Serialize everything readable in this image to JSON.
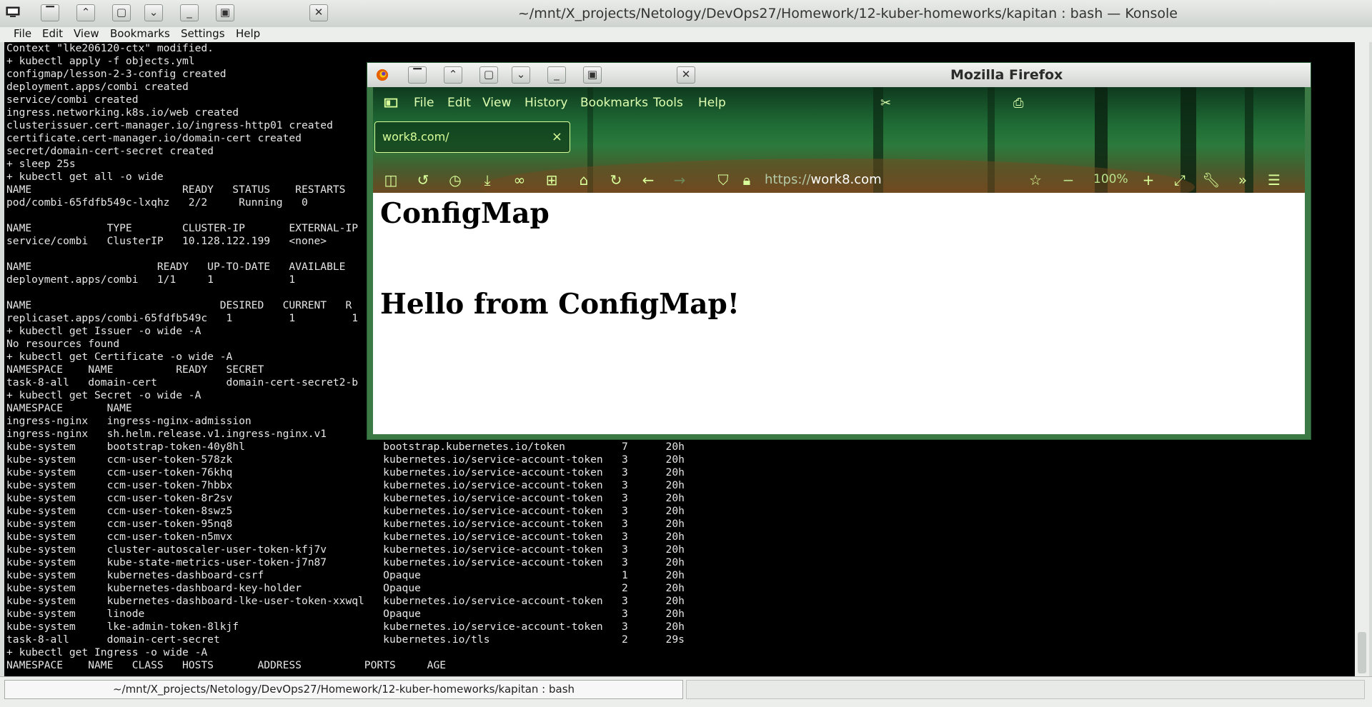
{
  "konsole": {
    "title": "~/mnt/X_projects/Netology/DevOps27/Homework/12-kuber-homeworks/kapitan : bash — Konsole",
    "menu": [
      "File",
      "Edit",
      "View",
      "Bookmarks",
      "Settings",
      "Help"
    ],
    "tab_title": "~/mnt/X_projects/Netology/DevOps27/Homework/12-kuber-homeworks/kapitan : bash",
    "lines": [
      "Context \"lke206120-ctx\" modified.",
      "+ kubectl apply -f objects.yml",
      "configmap/lesson-2-3-config created",
      "deployment.apps/combi created",
      "service/combi created",
      "ingress.networking.k8s.io/web created",
      "clusterissuer.cert-manager.io/ingress-http01 created",
      "certificate.cert-manager.io/domain-cert created",
      "secret/domain-cert-secret created",
      "+ sleep 25s",
      "+ kubectl get all -o wide",
      "NAME                        READY   STATUS    RESTARTS",
      "pod/combi-65fdfb549c-lxqhz   2/2     Running   0",
      "",
      "NAME            TYPE        CLUSTER-IP       EXTERNAL-IP",
      "service/combi   ClusterIP   10.128.122.199   <none>",
      "",
      "NAME                    READY   UP-TO-DATE   AVAILABLE",
      "deployment.apps/combi   1/1     1            1",
      "",
      "NAME                              DESIRED   CURRENT   R",
      "replicaset.apps/combi-65fdfb549c   1         1         1",
      "+ kubectl get Issuer -o wide -A",
      "No resources found",
      "+ kubectl get Certificate -o wide -A",
      "NAMESPACE    NAME          READY   SECRET",
      "task-8-all   domain-cert           domain-cert-secret2-b",
      "+ kubectl get Secret -o wide -A",
      "NAMESPACE       NAME",
      "ingress-nginx   ingress-nginx-admission",
      "ingress-nginx   sh.helm.release.v1.ingress-nginx.v1",
      "kube-system     bootstrap-token-40y8hl                      bootstrap.kubernetes.io/token         7      20h",
      "kube-system     ccm-user-token-578zk                        kubernetes.io/service-account-token   3      20h",
      "kube-system     ccm-user-token-76khq                        kubernetes.io/service-account-token   3      20h",
      "kube-system     ccm-user-token-7hbbx                        kubernetes.io/service-account-token   3      20h",
      "kube-system     ccm-user-token-8r2sv                        kubernetes.io/service-account-token   3      20h",
      "kube-system     ccm-user-token-8swz5                        kubernetes.io/service-account-token   3      20h",
      "kube-system     ccm-user-token-95nq8                        kubernetes.io/service-account-token   3      20h",
      "kube-system     ccm-user-token-n5mvx                        kubernetes.io/service-account-token   3      20h",
      "kube-system     cluster-autoscaler-user-token-kfj7v         kubernetes.io/service-account-token   3      20h",
      "kube-system     kube-state-metrics-user-token-j7n87         kubernetes.io/service-account-token   3      20h",
      "kube-system     kubernetes-dashboard-csrf                   Opaque                                1      20h",
      "kube-system     kubernetes-dashboard-key-holder             Opaque                                2      20h",
      "kube-system     kubernetes-dashboard-lke-user-token-xxwql   kubernetes.io/service-account-token   3      20h",
      "kube-system     linode                                      Opaque                                3      20h",
      "kube-system     lke-admin-token-8lkjf                       kubernetes.io/service-account-token   3      20h",
      "task-8-all      domain-cert-secret                          kubernetes.io/tls                     2      29s",
      "+ kubectl get Ingress -o wide -A",
      "NAMESPACE    NAME   CLASS   HOSTS       ADDRESS          PORTS     AGE"
    ]
  },
  "firefox": {
    "title": "Mozilla Firefox",
    "menu": [
      "File",
      "Edit",
      "View",
      "History",
      "Bookmarks",
      "Tools",
      "Help"
    ],
    "tab_title": "work8.com/",
    "url_scheme": "https://",
    "url_host": "work8.com",
    "zoom": "100%",
    "page": {
      "heading1": "ConfigMap",
      "heading2": "Hello from ConfigMap!"
    }
  }
}
